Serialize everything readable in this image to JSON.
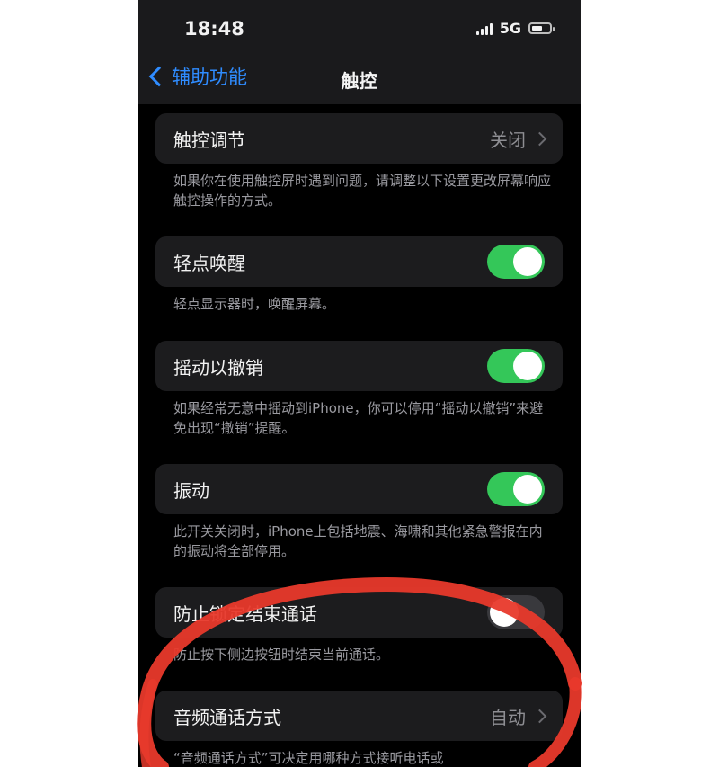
{
  "status": {
    "time": "18:48",
    "network": "5G",
    "battery_level": 0.6,
    "signal_bars": 4
  },
  "nav": {
    "back_label": "辅助功能",
    "title": "触控"
  },
  "settings": [
    {
      "label": "触控调节",
      "value": "关闭",
      "type": "disclosure",
      "description": "如果你在使用触控屏时遇到问题，请调整以下设置更改屏幕响应触控操作的方式。"
    },
    {
      "label": "轻点唤醒",
      "type": "toggle",
      "on": true,
      "description": "轻点显示器时，唤醒屏幕。"
    },
    {
      "label": "摇动以撤销",
      "type": "toggle",
      "on": true,
      "description": "如果经常无意中摇动到iPhone，你可以停用“摇动以撤销”来避免出现“撤销”提醒。"
    },
    {
      "label": "振动",
      "type": "toggle",
      "on": true,
      "description": "此开关关闭时，iPhone上包括地震、海啸和其他紧急警报在内的振动将全部停用。"
    },
    {
      "label": "防止锁定结束通话",
      "type": "toggle",
      "on": false,
      "description": "防止按下侧边按钮时结束当前通话。"
    },
    {
      "label": "音频通话方式",
      "value": "自动",
      "type": "disclosure",
      "description": "“音频通话方式”可决定用哪种方式接听电话或"
    }
  ],
  "colors": {
    "toggle_on": "#34c759",
    "accent": "#2f8cff",
    "annotation": "#e8392b"
  }
}
